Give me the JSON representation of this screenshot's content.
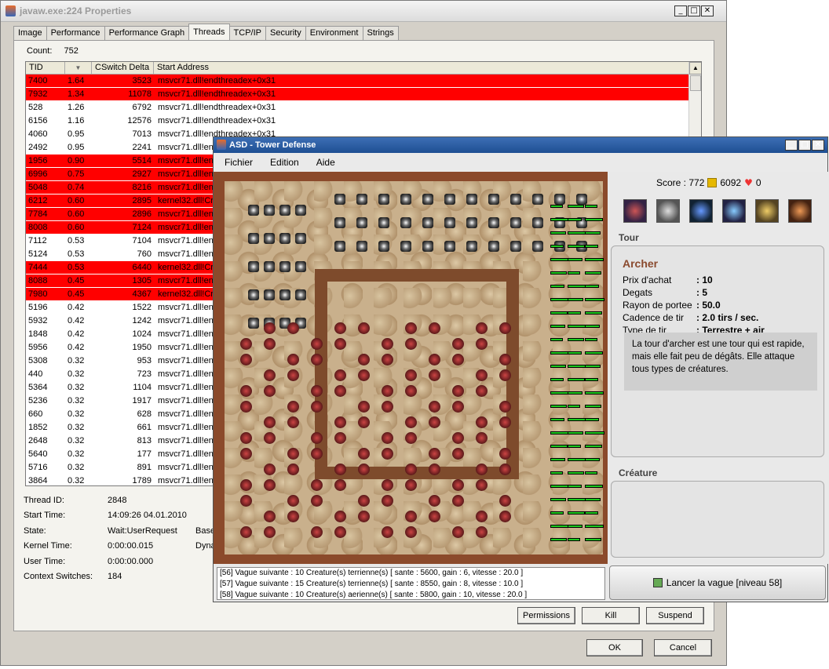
{
  "props": {
    "title": "javaw.exe:224 Properties",
    "tabs": [
      "Image",
      "Performance",
      "Performance Graph",
      "Threads",
      "TCP/IP",
      "Security",
      "Environment",
      "Strings"
    ],
    "active_tab": "Threads",
    "count_label": "Count:",
    "count_value": "752",
    "columns": [
      "TID",
      "",
      "CSwitch Delta",
      "Start Address"
    ],
    "rows": [
      {
        "tid": "7400",
        "cpu": "1.64",
        "cs": "3523",
        "addr": "msvcr71.dll!endthreadex+0x31",
        "hl": true
      },
      {
        "tid": "7932",
        "cpu": "1.34",
        "cs": "11078",
        "addr": "msvcr71.dll!endthreadex+0x31",
        "hl": true
      },
      {
        "tid": "528",
        "cpu": "1.26",
        "cs": "6792",
        "addr": "msvcr71.dll!endthreadex+0x31",
        "hl": false
      },
      {
        "tid": "6156",
        "cpu": "1.16",
        "cs": "12576",
        "addr": "msvcr71.dll!endthreadex+0x31",
        "hl": false
      },
      {
        "tid": "4060",
        "cpu": "0.95",
        "cs": "7013",
        "addr": "msvcr71.dll!endthreadex+0x31",
        "hl": false
      },
      {
        "tid": "2492",
        "cpu": "0.95",
        "cs": "2241",
        "addr": "msvcr71.dll!enc",
        "hl": false
      },
      {
        "tid": "1956",
        "cpu": "0.90",
        "cs": "5514",
        "addr": "msvcr71.dll!enc",
        "hl": true
      },
      {
        "tid": "6996",
        "cpu": "0.75",
        "cs": "2927",
        "addr": "msvcr71.dll!enc",
        "hl": true
      },
      {
        "tid": "5048",
        "cpu": "0.74",
        "cs": "8216",
        "addr": "msvcr71.dll!enc",
        "hl": true
      },
      {
        "tid": "6212",
        "cpu": "0.60",
        "cs": "2895",
        "addr": "kernel32.dll!Cre",
        "hl": true
      },
      {
        "tid": "7784",
        "cpu": "0.60",
        "cs": "2896",
        "addr": "msvcr71.dll!enc",
        "hl": true
      },
      {
        "tid": "8008",
        "cpu": "0.60",
        "cs": "7124",
        "addr": "msvcr71.dll!enc",
        "hl": true
      },
      {
        "tid": "7112",
        "cpu": "0.53",
        "cs": "7104",
        "addr": "msvcr71.dll!enc",
        "hl": false
      },
      {
        "tid": "5124",
        "cpu": "0.53",
        "cs": "760",
        "addr": "msvcr71.dll!enc",
        "hl": false
      },
      {
        "tid": "7444",
        "cpu": "0.53",
        "cs": "6440",
        "addr": "kernel32.dll!Cre",
        "hl": true
      },
      {
        "tid": "8088",
        "cpu": "0.45",
        "cs": "1305",
        "addr": "msvcr71.dll!enc",
        "hl": true
      },
      {
        "tid": "7980",
        "cpu": "0.45",
        "cs": "4367",
        "addr": "kernel32.dll!Cre",
        "hl": true
      },
      {
        "tid": "5196",
        "cpu": "0.42",
        "cs": "1522",
        "addr": "msvcr71.dll!enc",
        "hl": false
      },
      {
        "tid": "5932",
        "cpu": "0.42",
        "cs": "1242",
        "addr": "msvcr71.dll!enc",
        "hl": false
      },
      {
        "tid": "1848",
        "cpu": "0.42",
        "cs": "1024",
        "addr": "msvcr71.dll!enc",
        "hl": false
      },
      {
        "tid": "5956",
        "cpu": "0.42",
        "cs": "1950",
        "addr": "msvcr71.dll!enc",
        "hl": false
      },
      {
        "tid": "5308",
        "cpu": "0.32",
        "cs": "953",
        "addr": "msvcr71.dll!enc",
        "hl": false
      },
      {
        "tid": "440",
        "cpu": "0.32",
        "cs": "723",
        "addr": "msvcr71.dll!enc",
        "hl": false
      },
      {
        "tid": "5364",
        "cpu": "0.32",
        "cs": "1104",
        "addr": "msvcr71.dll!enc",
        "hl": false
      },
      {
        "tid": "5236",
        "cpu": "0.32",
        "cs": "1917",
        "addr": "msvcr71.dll!enc",
        "hl": false
      },
      {
        "tid": "660",
        "cpu": "0.32",
        "cs": "628",
        "addr": "msvcr71.dll!enc",
        "hl": false
      },
      {
        "tid": "1852",
        "cpu": "0.32",
        "cs": "661",
        "addr": "msvcr71.dll!enc",
        "hl": false
      },
      {
        "tid": "2648",
        "cpu": "0.32",
        "cs": "813",
        "addr": "msvcr71.dll!enc",
        "hl": false
      },
      {
        "tid": "5640",
        "cpu": "0.32",
        "cs": "177",
        "addr": "msvcr71.dll!enc",
        "hl": false
      },
      {
        "tid": "5716",
        "cpu": "0.32",
        "cs": "891",
        "addr": "msvcr71.dll!enc",
        "hl": false
      },
      {
        "tid": "3864",
        "cpu": "0.32",
        "cs": "1789",
        "addr": "msvcr71.dll!enc",
        "hl": false
      }
    ],
    "details": [
      {
        "label": "Thread ID:",
        "value": "2848"
      },
      {
        "label": "Start Time:",
        "value": "14:09:26   04.01.2010"
      },
      {
        "label": "State:",
        "value": "Wait:UserRequest"
      },
      {
        "label": "Kernel Time:",
        "value": "0:00:00.015"
      },
      {
        "label": "User Time:",
        "value": "0:00:00.000"
      },
      {
        "label": "Context Switches:",
        "value": "184"
      }
    ],
    "extra_labels": {
      "base": "Base",
      "dyn": "Dyna"
    },
    "buttons": {
      "permissions": "Permissions",
      "kill": "Kill",
      "suspend": "Suspend",
      "ok": "OK",
      "cancel": "Cancel"
    }
  },
  "game": {
    "title": "ASD - Tower Defense",
    "menu": [
      "Fichier",
      "Edition",
      "Aide"
    ],
    "score_label": "Score : 772",
    "gold": "6092",
    "lives": "0",
    "tour_header": "Tour",
    "tower": {
      "name": "Archer",
      "stats": [
        {
          "k": "Prix d'achat",
          "v": ": 10"
        },
        {
          "k": "Degats",
          "v": ": 5"
        },
        {
          "k": "Rayon de portee",
          "v": ": 50.0"
        },
        {
          "k": "Cadence de tir",
          "v": ": 2.0 tirs / sec."
        },
        {
          "k": "Type de tir",
          "v": ": Terrestre + air"
        }
      ],
      "description": "La tour d'archer est une tour qui est rapide, mais elle fait peu de dégâts. Elle attaque tous types de créatures."
    },
    "creature_header": "Créature",
    "log": [
      "[56] Vague suivante : 10 Creature(s) terrienne(s) [ sante : 5600, gain : 6, vitesse : 20.0 ]",
      "[57] Vague suivante : 15 Creature(s) terrienne(s) [ sante : 8550, gain : 8, vitesse : 10.0 ]",
      "[58] Vague suivante : 10 Creature(s) aerienne(s) [ sante : 5800, gain : 10, vitesse : 20.0 ]"
    ],
    "launch_button": "Lancer la vague [niveau 58]",
    "colors": {
      "title_bar": "#2a5aa0",
      "tower_name": "#8a4a2e",
      "highlight_row": "#ff0000"
    }
  }
}
